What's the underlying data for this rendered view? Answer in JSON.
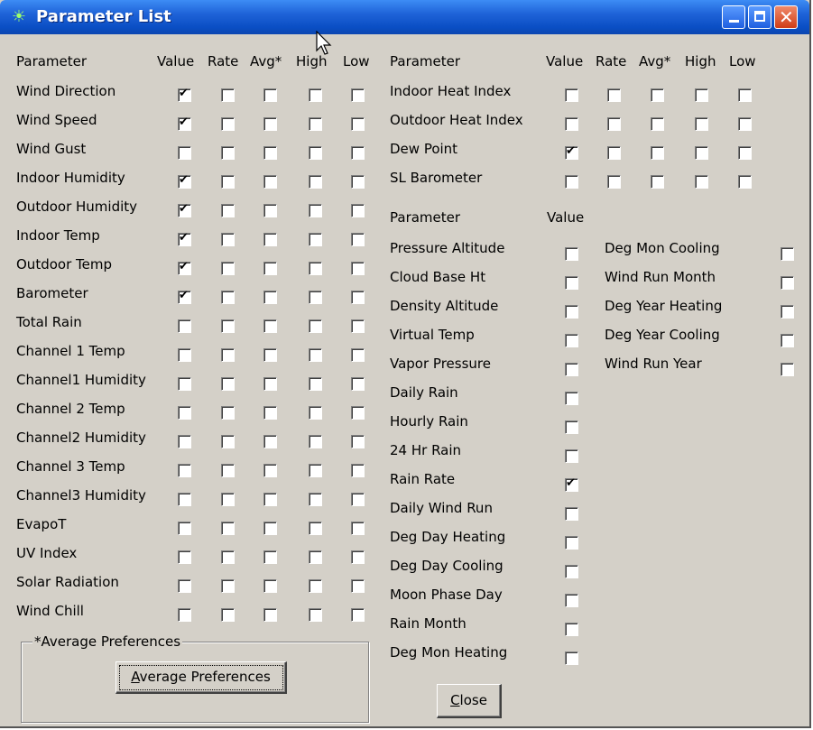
{
  "window": {
    "title": "Parameter List",
    "app_icon": "weather-station-icon"
  },
  "headers": {
    "parameter": "Parameter",
    "value": "Value",
    "rate": "Rate",
    "avg": "Avg*",
    "high": "High",
    "low": "Low"
  },
  "left_rows": [
    {
      "label": "Wind Direction",
      "checks": [
        true,
        false,
        false,
        false,
        false
      ]
    },
    {
      "label": "Wind Speed",
      "checks": [
        true,
        false,
        false,
        false,
        false
      ]
    },
    {
      "label": "Wind Gust",
      "checks": [
        false,
        false,
        false,
        false,
        false
      ]
    },
    {
      "label": "Indoor Humidity",
      "checks": [
        true,
        false,
        false,
        false,
        false
      ]
    },
    {
      "label": "Outdoor Humidity",
      "checks": [
        true,
        false,
        false,
        false,
        false
      ]
    },
    {
      "label": "Indoor Temp",
      "checks": [
        true,
        false,
        false,
        false,
        false
      ]
    },
    {
      "label": "Outdoor Temp",
      "checks": [
        true,
        false,
        false,
        false,
        false
      ]
    },
    {
      "label": "Barometer",
      "checks": [
        true,
        false,
        false,
        false,
        false
      ]
    },
    {
      "label": "Total Rain",
      "checks": [
        false,
        false,
        false,
        false,
        false
      ]
    },
    {
      "label": "Channel 1 Temp",
      "checks": [
        false,
        false,
        false,
        false,
        false
      ]
    },
    {
      "label": "Channel1 Humidity",
      "checks": [
        false,
        false,
        false,
        false,
        false
      ]
    },
    {
      "label": "Channel 2 Temp",
      "checks": [
        false,
        false,
        false,
        false,
        false
      ]
    },
    {
      "label": "Channel2 Humidity",
      "checks": [
        false,
        false,
        false,
        false,
        false
      ]
    },
    {
      "label": "Channel 3 Temp",
      "checks": [
        false,
        false,
        false,
        false,
        false
      ]
    },
    {
      "label": "Channel3 Humidity",
      "checks": [
        false,
        false,
        false,
        false,
        false
      ]
    },
    {
      "label": "EvapoT",
      "checks": [
        false,
        false,
        false,
        false,
        false
      ]
    },
    {
      "label": "UV Index",
      "checks": [
        false,
        false,
        false,
        false,
        false
      ]
    },
    {
      "label": "Solar Radiation",
      "checks": [
        false,
        false,
        false,
        false,
        false
      ]
    },
    {
      "label": "Wind Chill",
      "checks": [
        false,
        false,
        false,
        false,
        false
      ]
    }
  ],
  "right_top_rows": [
    {
      "label": "Indoor Heat Index",
      "checks": [
        false,
        false,
        false,
        false,
        false
      ]
    },
    {
      "label": "Outdoor Heat Index",
      "checks": [
        false,
        false,
        false,
        false,
        false
      ]
    },
    {
      "label": "Dew Point",
      "checks": [
        true,
        false,
        false,
        false,
        false
      ]
    },
    {
      "label": "SL Barometer",
      "checks": [
        false,
        false,
        false,
        false,
        false
      ]
    }
  ],
  "value_section": {
    "parameter_header": "Parameter",
    "value_header": "Value",
    "col1": [
      {
        "label": "Pressure Altitude",
        "checked": false
      },
      {
        "label": "Cloud Base Ht",
        "checked": false
      },
      {
        "label": "Density Altitude",
        "checked": false
      },
      {
        "label": "Virtual Temp",
        "checked": false
      },
      {
        "label": "Vapor Pressure",
        "checked": false
      },
      {
        "label": "Daily Rain",
        "checked": false
      },
      {
        "label": "Hourly Rain",
        "checked": false
      },
      {
        "label": "24 Hr Rain",
        "checked": false
      },
      {
        "label": "Rain Rate",
        "checked": true
      },
      {
        "label": "Daily Wind Run",
        "checked": false
      },
      {
        "label": "Deg Day Heating",
        "checked": false
      },
      {
        "label": "Deg Day Cooling",
        "checked": false
      },
      {
        "label": "Moon Phase Day",
        "checked": false
      },
      {
        "label": "Rain Month",
        "checked": false
      },
      {
        "label": "Deg Mon Heating",
        "checked": false
      }
    ],
    "col2": [
      {
        "label": "Deg Mon Cooling",
        "checked": false
      },
      {
        "label": "Wind Run Month",
        "checked": false
      },
      {
        "label": "Deg Year Heating",
        "checked": false
      },
      {
        "label": "Deg Year Cooling",
        "checked": false
      },
      {
        "label": "Wind Run Year",
        "checked": false
      }
    ]
  },
  "average_prefs": {
    "group_label": "*Average Preferences",
    "button_access_key": "A",
    "button_rest": "verage Preferences"
  },
  "close_button": {
    "access_key": "C",
    "rest": "lose"
  },
  "colors": {
    "titlebar": "#0a4ec4",
    "face": "#d4d0c8",
    "close": "#d03d16"
  }
}
